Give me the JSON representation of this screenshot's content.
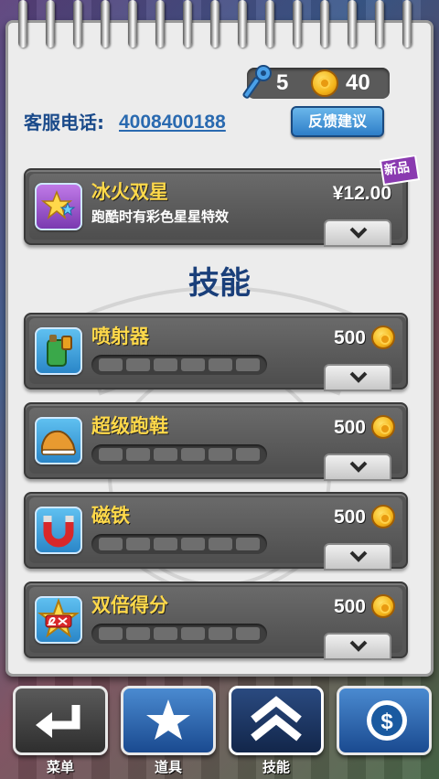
{
  "header": {
    "keys": "5",
    "coins": "40"
  },
  "support": {
    "label": "客服电话:",
    "phone": "4008400188",
    "feedback_button": "反馈建议"
  },
  "featured": {
    "badge": "新品",
    "name": "冰火双星",
    "description": "跑酷时有彩色星星特效",
    "price": "¥12.00"
  },
  "section_title": "技能",
  "skills": [
    {
      "name": "喷射器",
      "price": "500",
      "level": 0,
      "max_level": 6
    },
    {
      "name": "超级跑鞋",
      "price": "500",
      "level": 0,
      "max_level": 6
    },
    {
      "name": "磁铁",
      "price": "500",
      "level": 0,
      "max_level": 6
    },
    {
      "name": "双倍得分",
      "price": "500",
      "level": 0,
      "max_level": 6
    }
  ],
  "nav": {
    "menu": "菜单",
    "items": "道具",
    "skills": "技能"
  },
  "colors": {
    "accent_gold": "#ffd94a",
    "title_blue": "#1a3f7a",
    "card_gray": "#555555"
  }
}
